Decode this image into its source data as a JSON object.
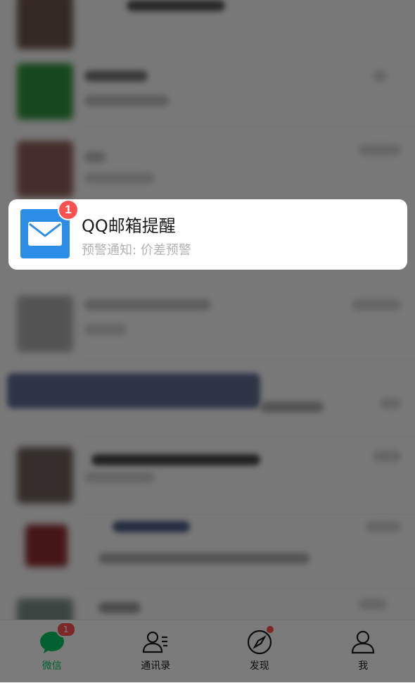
{
  "highlighted_chat": {
    "title": "QQ邮箱提醒",
    "preview": "预警通知: 价差预警",
    "unread_count": "1",
    "icon": "mail-envelope-icon",
    "icon_bg": "#2b8de6"
  },
  "tabbar": {
    "tabs": [
      {
        "label": "微信",
        "icon": "chat-bubble-icon",
        "active": true,
        "badge": "1"
      },
      {
        "label": "通讯录",
        "icon": "contacts-icon",
        "active": false
      },
      {
        "label": "发现",
        "icon": "compass-icon",
        "active": false,
        "dot": true
      },
      {
        "label": "我",
        "icon": "person-icon",
        "active": false
      }
    ]
  },
  "colors": {
    "accent": "#07c160",
    "badge": "#fa5151"
  }
}
